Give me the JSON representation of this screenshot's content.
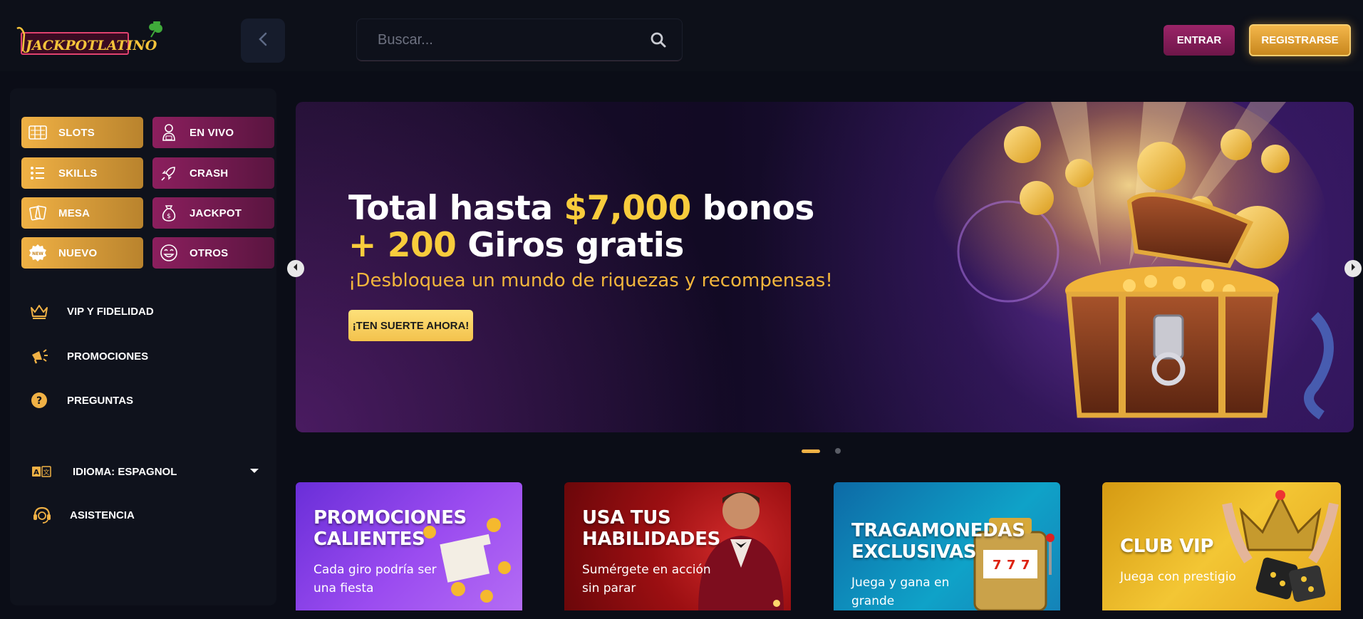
{
  "brand": {
    "name": "JACKPOT LATINO"
  },
  "header": {
    "search_placeholder": "Buscar...",
    "login_label": "ENTRAR",
    "register_label": "REGISTRARSE"
  },
  "sidebar": {
    "categories": [
      {
        "label": "SLOTS",
        "icon": "slot-machine-icon"
      },
      {
        "label": "EN VIVO",
        "icon": "live-dealer-icon"
      },
      {
        "label": "SKILLS",
        "icon": "list-icon"
      },
      {
        "label": "CRASH",
        "icon": "rocket-icon"
      },
      {
        "label": "MESA",
        "icon": "cards-icon"
      },
      {
        "label": "JACKPOT",
        "icon": "money-bag-icon"
      },
      {
        "label": "NUEVO",
        "icon": "new-badge-icon"
      },
      {
        "label": "OTROS",
        "icon": "smiley-icon"
      }
    ],
    "menu": [
      {
        "label": "VIP Y FIDELIDAD",
        "icon": "crown-icon"
      },
      {
        "label": "PROMOCIONES",
        "icon": "megaphone-icon"
      },
      {
        "label": "PREGUNTAS",
        "icon": "question-icon"
      }
    ],
    "language_label": "IDIOMA: ESPAGNOL",
    "support_label": "ASISTENCIA"
  },
  "banner": {
    "title_line1_a": "Total hasta ",
    "title_line1_amount": "$7,000",
    "title_line1_b": " bonos",
    "title_line2_amount": "+ 200",
    "title_line2_b": " Giros gratis",
    "subtitle": "¡Desbloquea un mundo de riquezas y recompensas!",
    "cta_label": "¡TEN SUERTE AHORA!"
  },
  "carousel": {
    "active_index": 0,
    "count": 2
  },
  "cards": [
    {
      "title_1": "PROMOCIONES",
      "title_2": "CALIENTES",
      "desc": "Cada giro podría ser una fiesta"
    },
    {
      "title_1": "USA TUS",
      "title_2": "HABILIDADES",
      "desc": "Sumérgete en acción sin parar"
    },
    {
      "title_1": "TRAGAMONEDAS",
      "title_2": "EXCLUSIVAS",
      "desc": "Juega y gana en grande"
    },
    {
      "title_1": "CLUB VIP",
      "title_2": "",
      "desc": "Juega con prestigio"
    }
  ],
  "colors": {
    "gold": "#f0b145",
    "magenta": "#8c1f5e",
    "accent_yellow": "#f8cc3c",
    "background": "#0b0d17"
  }
}
